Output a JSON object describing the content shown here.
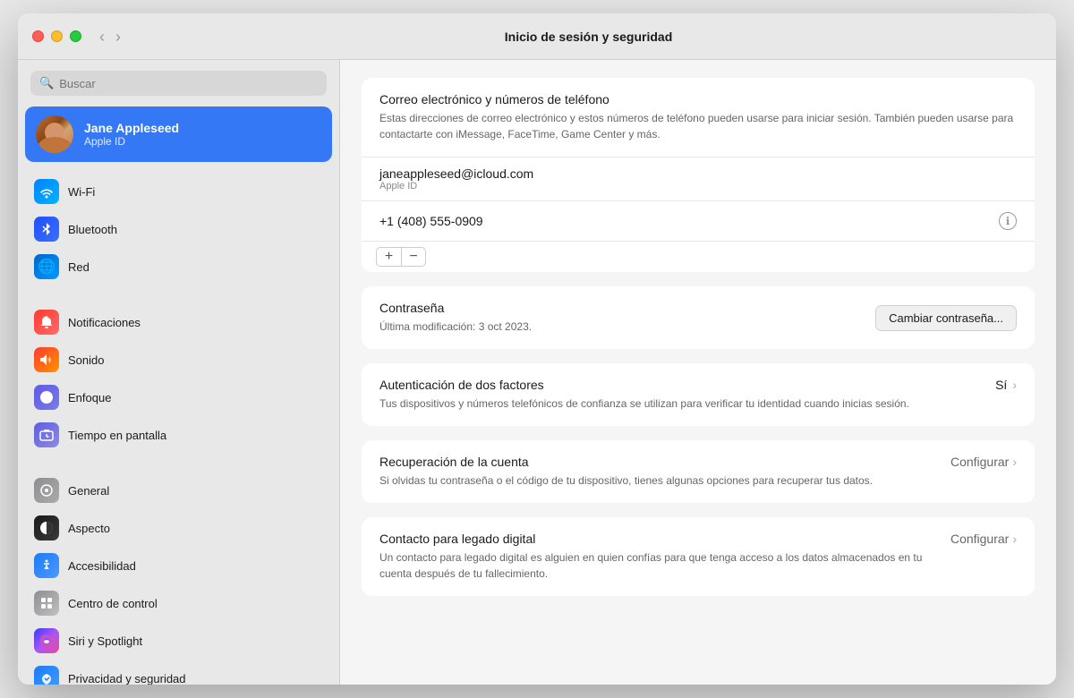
{
  "window": {
    "title": "Inicio de sesión y seguridad"
  },
  "titlebar": {
    "back_label": "‹",
    "forward_label": "›"
  },
  "sidebar": {
    "search_placeholder": "Buscar",
    "user": {
      "name": "Jane Appleseed",
      "subtitle": "Apple ID"
    },
    "items": [
      {
        "id": "wifi",
        "label": "Wi-Fi",
        "icon_class": "icon-wifi",
        "icon_char": "📶"
      },
      {
        "id": "bluetooth",
        "label": "Bluetooth",
        "icon_class": "icon-bluetooth",
        "icon_char": "⬡"
      },
      {
        "id": "network",
        "label": "Red",
        "icon_class": "icon-network",
        "icon_char": "🌐"
      },
      {
        "id": "notifications",
        "label": "Notificaciones",
        "icon_class": "icon-notifications",
        "icon_char": "🔔"
      },
      {
        "id": "sound",
        "label": "Sonido",
        "icon_class": "icon-sound",
        "icon_char": "🔊"
      },
      {
        "id": "focus",
        "label": "Enfoque",
        "icon_class": "icon-focus",
        "icon_char": "🌙"
      },
      {
        "id": "screentime",
        "label": "Tiempo en pantalla",
        "icon_class": "icon-screentime",
        "icon_char": "⏱"
      },
      {
        "id": "general",
        "label": "General",
        "icon_class": "icon-general",
        "icon_char": "⚙"
      },
      {
        "id": "appearance",
        "label": "Aspecto",
        "icon_class": "icon-appearance",
        "icon_char": "◑"
      },
      {
        "id": "accessibility",
        "label": "Accesibilidad",
        "icon_class": "icon-accessibility",
        "icon_char": "♿"
      },
      {
        "id": "controlcenter",
        "label": "Centro de control",
        "icon_class": "icon-controlcenter",
        "icon_char": "⊞"
      },
      {
        "id": "siri",
        "label": "Siri y Spotlight",
        "icon_class": "icon-siri",
        "icon_char": "◉"
      },
      {
        "id": "privacy",
        "label": "Privacidad y seguridad",
        "icon_class": "icon-privacy",
        "icon_char": "✋"
      }
    ]
  },
  "content": {
    "email_section": {
      "title": "Correo electrónico y números de teléfono",
      "description": "Estas direcciones de correo electrónico y estos números de teléfono pueden usarse para iniciar sesión. También pueden usarse para contactarte con iMessage, FaceTime, Game Center y más.",
      "email": "janeappleseed@icloud.com",
      "email_label": "Apple ID",
      "phone": "+1 (408) 555-0909",
      "add_btn": "+",
      "remove_btn": "−"
    },
    "password_section": {
      "title": "Contraseña",
      "subtitle": "Última modificación: 3 oct 2023.",
      "change_btn": "Cambiar contraseña..."
    },
    "two_factor": {
      "title": "Autenticación de dos factores",
      "description": "Tus dispositivos y números telefónicos de confianza se utilizan para verificar tu identidad cuando inicias sesión.",
      "status": "Sí"
    },
    "recovery": {
      "title": "Recuperación de la cuenta",
      "description": "Si olvidas tu contraseña o el código de tu dispositivo, tienes algunas opciones para recuperar tus datos.",
      "action": "Configurar"
    },
    "legacy": {
      "title": "Contacto para legado digital",
      "description": "Un contacto para legado digital es alguien en quien confías para que tenga acceso a los datos almacenados en tu cuenta después de tu fallecimiento.",
      "action": "Configurar"
    }
  }
}
